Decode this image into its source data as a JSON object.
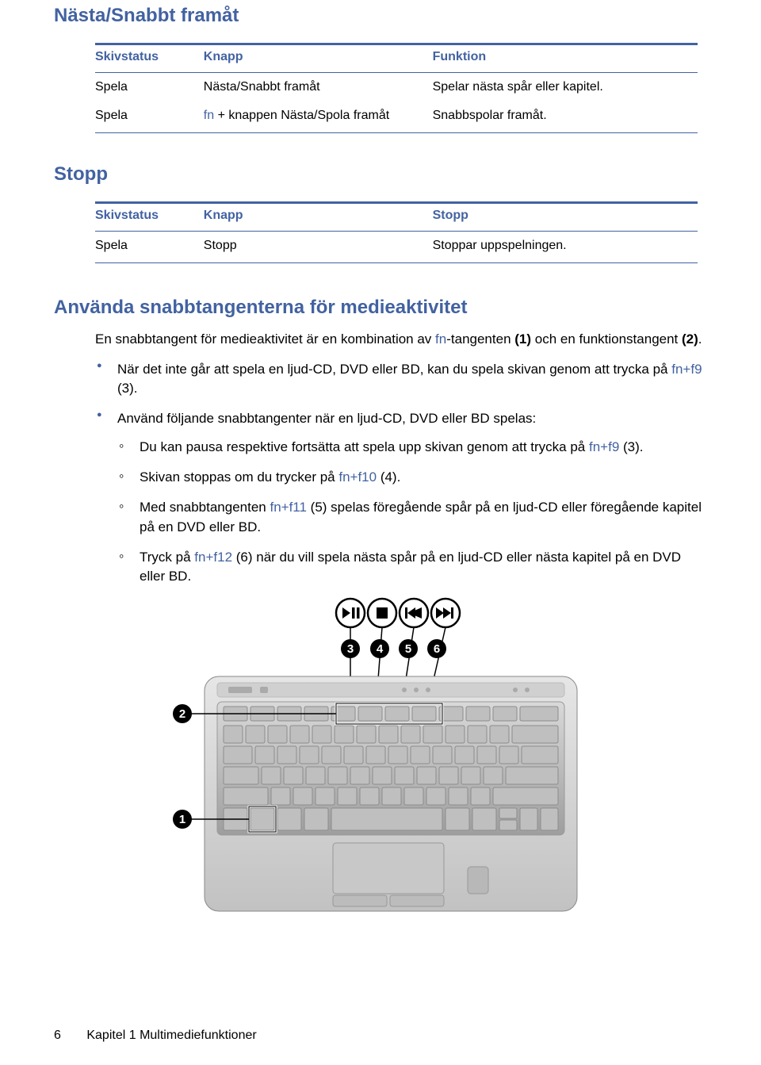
{
  "headings": {
    "h1": "Nästa/Snabbt framåt",
    "h2": "Stopp",
    "h3": "Använda snabbtangenterna för medieaktivitet"
  },
  "table1": {
    "head": {
      "c1": "Skivstatus",
      "c2": "Knapp",
      "c3": "Funktion"
    },
    "r1": {
      "c1": "Spela",
      "c2": "Nästa/Snabbt framåt",
      "c3": "Spelar nästa spår eller kapitel."
    },
    "r2": {
      "c1": "Spela",
      "c2a": "fn",
      "c2b": " + knappen Nästa/Spola framåt",
      "c3": "Snabbspolar framåt."
    }
  },
  "table2": {
    "head": {
      "c1": "Skivstatus",
      "c2": "Knapp",
      "c3": "Stopp"
    },
    "r1": {
      "c1": "Spela",
      "c2": "Stopp",
      "c3": "Stoppar uppspelningen."
    }
  },
  "intro": {
    "a": "En snabbtangent för medieaktivitet är en kombination av ",
    "fn": "fn",
    "b": "-tangenten ",
    "one": "(1)",
    "c": " och en funktionstangent ",
    "two": "(2)",
    "d": "."
  },
  "b1": {
    "a": "När det inte går att spela en ljud-CD, DVD eller BD, kan du spela skivan genom att trycka på ",
    "k": "fn+f9",
    "b": " (3)."
  },
  "b2": {
    "a": "Använd följande snabbtangenter när en ljud-CD, DVD eller BD spelas:"
  },
  "s1": {
    "a": "Du kan pausa respektive fortsätta att spela upp skivan genom att trycka på ",
    "k": "fn+f9",
    "b": " (3)."
  },
  "s2": {
    "a": "Skivan stoppas om du trycker på ",
    "k": "fn+f10",
    "b": " (4)."
  },
  "s3": {
    "a": "Med snabbtangenten ",
    "k": "fn+f11",
    "b": " (5) spelas föregående spår på en ljud-CD eller föregående kapitel på en DVD eller BD."
  },
  "s4": {
    "a": "Tryck på ",
    "k": "fn+f12",
    "b": " (6) när du vill spela nästa spår på en ljud-CD eller nästa kapitel på en DVD eller BD."
  },
  "callouts": {
    "c1": "1",
    "c2": "2",
    "c3": "3",
    "c4": "4",
    "c5": "5",
    "c6": "6"
  },
  "footer": {
    "page": "6",
    "chapter": "Kapitel 1   Multimediefunktioner"
  }
}
